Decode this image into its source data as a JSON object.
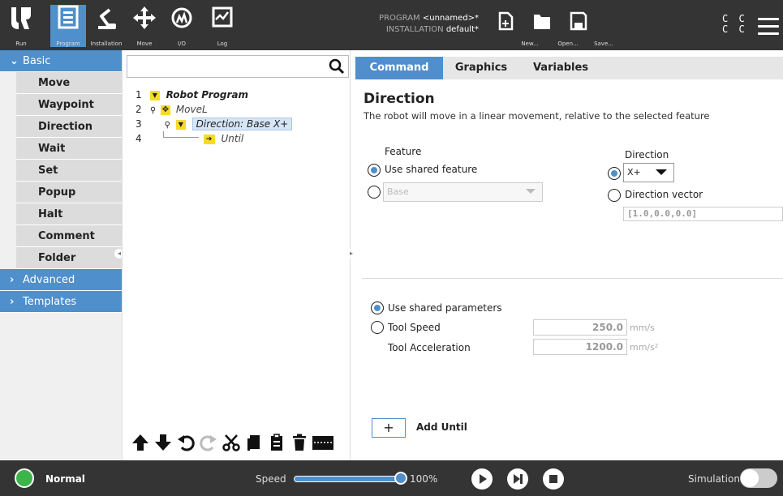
{
  "topbar": {
    "buttons": [
      {
        "label": "Run"
      },
      {
        "label": "Program"
      },
      {
        "label": "Installation"
      },
      {
        "label": "Move"
      },
      {
        "label": "I/O"
      },
      {
        "label": "Log"
      }
    ],
    "program_key": "PROGRAM",
    "program_value": "<unnamed>*",
    "installation_key": "INSTALLATION",
    "installation_value": "default*",
    "file_buttons": [
      {
        "label": "New..."
      },
      {
        "label": "Open..."
      },
      {
        "label": "Save..."
      }
    ],
    "cc_line1": "C C",
    "cc_line2": "C C"
  },
  "leftnav": {
    "basic_label": "Basic",
    "basic_items": [
      "Move",
      "Waypoint",
      "Direction",
      "Wait",
      "Set",
      "Popup",
      "Halt",
      "Comment",
      "Folder"
    ],
    "advanced_label": "Advanced",
    "templates_label": "Templates"
  },
  "tree": {
    "search_placeholder": "",
    "rows": [
      {
        "num": "1",
        "text": "Robot Program"
      },
      {
        "num": "2",
        "text": "MoveL"
      },
      {
        "num": "3",
        "text": "Direction: Base X+"
      },
      {
        "num": "4",
        "text": "Until"
      }
    ]
  },
  "tabs": {
    "command": "Command",
    "graphics": "Graphics",
    "variables": "Variables",
    "active": "Command"
  },
  "direction_panel": {
    "title": "Direction",
    "description": "The robot will move in a linear movement, relative to the selected feature",
    "feature_label": "Feature",
    "use_shared_feature": "Use shared feature",
    "feature_dropdown_value": "Base",
    "direction_label": "Direction",
    "direction_dropdown_value": "X+",
    "direction_vector_label": "Direction vector",
    "direction_vector_value": "[1.0,0.0,0.0]",
    "use_shared_parameters": "Use shared parameters",
    "tool_speed_label": "Tool Speed",
    "tool_speed_value": "250.0",
    "tool_speed_unit": "mm/s",
    "tool_accel_label": "Tool Acceleration",
    "tool_accel_value": "1200.0",
    "tool_accel_unit": "mm/s²",
    "add_until_plus": "+",
    "add_until_label": "Add Until"
  },
  "footer": {
    "status": "Normal",
    "speed_label": "Speed",
    "speed_value": "100%",
    "speed_fraction": 1.0,
    "simulation_label": "Simulation"
  },
  "colors": {
    "accent": "#4f8fcb",
    "topbar_bg": "#343434",
    "status_ok": "#3bb54a",
    "tree_marker": "#f6dc29"
  }
}
